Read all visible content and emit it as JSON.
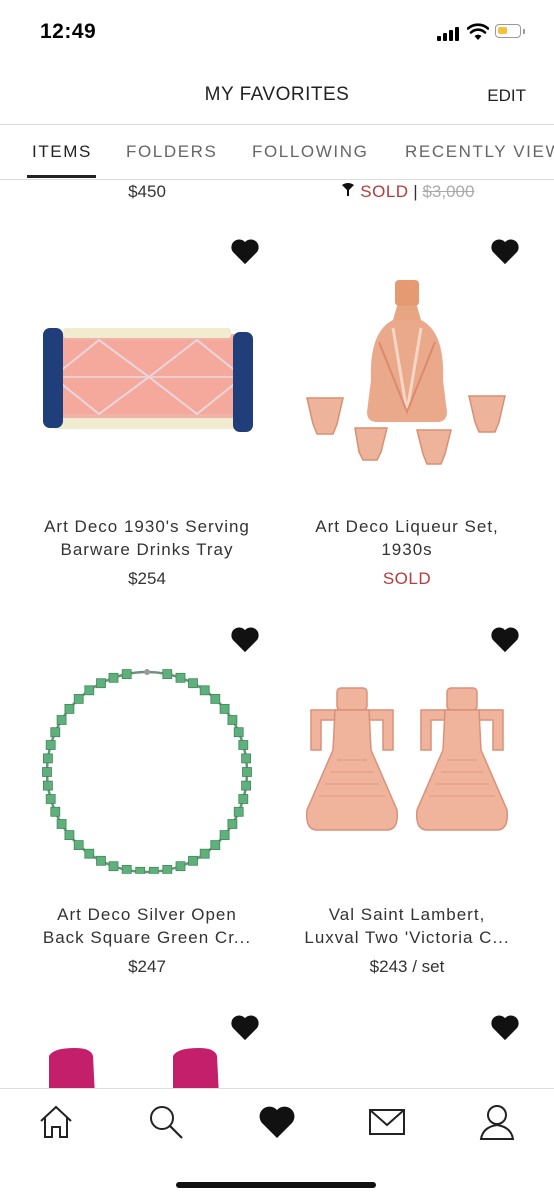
{
  "status_bar": {
    "time": "12:49",
    "battery_color": "#f2c23a"
  },
  "header": {
    "title": "MY FAVORITES",
    "edit_label": "EDIT"
  },
  "tabs": [
    {
      "label": "ITEMS",
      "active": true
    },
    {
      "label": "FOLDERS",
      "active": false
    },
    {
      "label": "FOLLOWING",
      "active": false
    },
    {
      "label": "RECENTLY VIEWED",
      "active": false
    }
  ],
  "partial_row": {
    "left_price": "$450",
    "right_sold": "SOLD",
    "right_separator": "|",
    "right_original_price": "$3,000"
  },
  "items": [
    {
      "title_line1": "Art Deco 1930's Serving",
      "title_line2": "Barware Drinks Tray",
      "price": "$254",
      "image": "pink-glass-drinks-tray-image"
    },
    {
      "title_line1": "Art Deco Liqueur Set,",
      "title_line2": "1930s",
      "price": "SOLD",
      "image": "pink-glass-decanter-set-image"
    },
    {
      "title_line1": "Art Deco Silver Open",
      "title_line2": "Back Square Green Cr...",
      "price": "$247",
      "image": "green-stone-necklace-image"
    },
    {
      "title_line1": "Val Saint Lambert,",
      "title_line2": "Luxval Two 'Victoria C...",
      "price": "$243 / set",
      "image": "pink-glass-candlesticks-image"
    }
  ],
  "bottom_nav": [
    {
      "name": "home",
      "icon": "home-icon"
    },
    {
      "name": "search",
      "icon": "search-icon"
    },
    {
      "name": "favorites",
      "icon": "heart-icon",
      "active": true
    },
    {
      "name": "messages",
      "icon": "envelope-icon"
    },
    {
      "name": "account",
      "icon": "user-icon"
    }
  ],
  "colors": {
    "sold_red": "#b83a3a",
    "text": "#222222",
    "divider": "#dddddd"
  }
}
